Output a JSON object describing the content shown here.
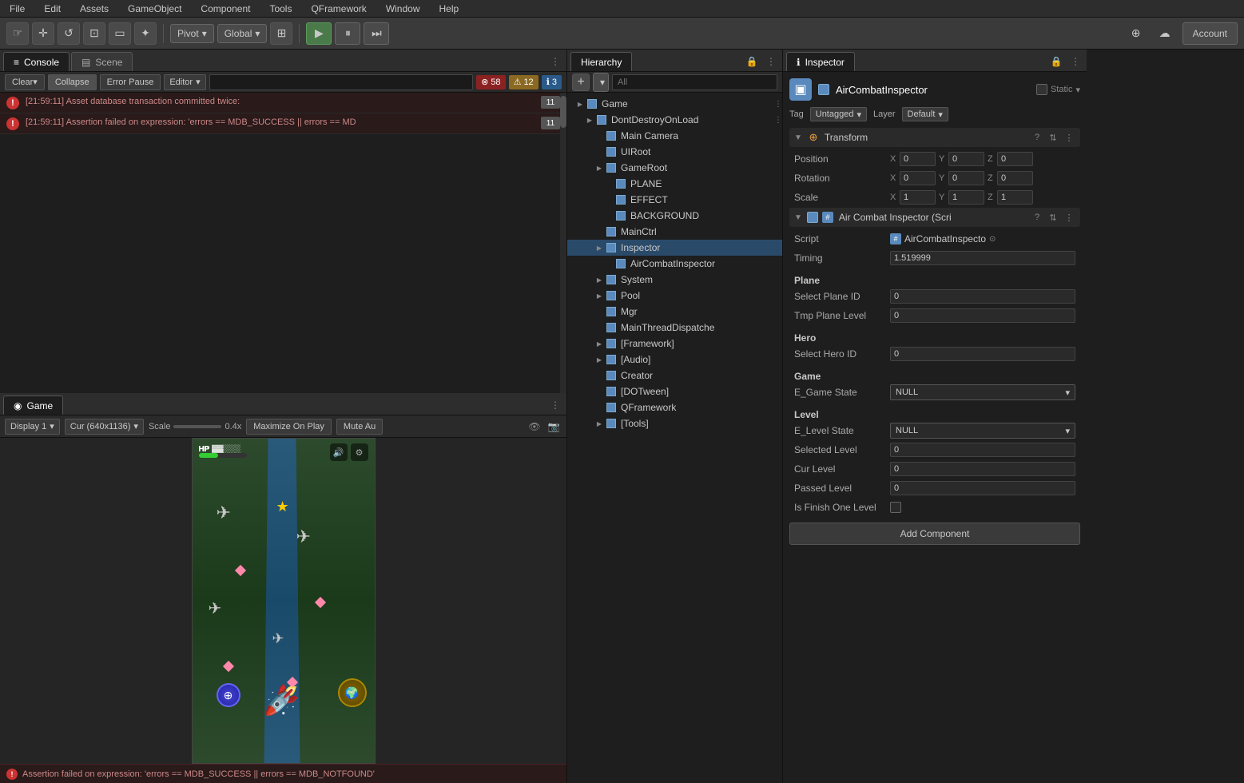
{
  "menu": {
    "items": [
      "File",
      "Edit",
      "Assets",
      "GameObject",
      "Component",
      "Tools",
      "QFramework",
      "Window",
      "Help"
    ]
  },
  "toolbar": {
    "tools": [
      "hand",
      "move",
      "rotate",
      "scale",
      "rect",
      "transform"
    ],
    "pivot_label": "Pivot",
    "global_label": "Global",
    "play_label": "▶",
    "pause_label": "⏸",
    "step_label": "⏭",
    "account_label": "Account"
  },
  "console": {
    "tab_label": "Console",
    "scene_tab_label": "Scene",
    "clear_label": "Clear",
    "collapse_label": "Collapse",
    "error_pause_label": "Error Pause",
    "editor_label": "Editor",
    "search_placeholder": "",
    "error_count": "58",
    "warn_count": "12",
    "info_count": "3",
    "messages": [
      {
        "type": "error",
        "text": "[21:59:11] Asset database transaction committed twice:",
        "count": "11"
      },
      {
        "type": "error",
        "text": "[21:59:11] Assertion failed on expression: 'errors == MDB_SUCCESS || errors == MD",
        "count": "11"
      }
    ]
  },
  "game": {
    "tab_label": "Game",
    "display_label": "Display 1",
    "resolution_label": "Cur (640x1136)",
    "scale_label": "Scale",
    "scale_value": "0.4x",
    "maximize_label": "Maximize On Play",
    "mute_label": "Mute Au"
  },
  "error_bar": {
    "text": "Assertion failed on expression: 'errors == MDB_SUCCESS || errors == MDB_NOTFOUND'"
  },
  "hierarchy": {
    "tab_label": "Hierarchy",
    "search_placeholder": "All",
    "items": [
      {
        "label": "Game",
        "level": 0,
        "has_children": true,
        "icon": "cube"
      },
      {
        "label": "DontDestroyOnLoad",
        "level": 1,
        "has_children": true,
        "icon": "cube",
        "has_menu": true
      },
      {
        "label": "Main Camera",
        "level": 2,
        "has_children": false,
        "icon": "cube"
      },
      {
        "label": "UIRoot",
        "level": 2,
        "has_children": false,
        "icon": "cube"
      },
      {
        "label": "GameRoot",
        "level": 2,
        "has_children": true,
        "icon": "cube"
      },
      {
        "label": "PLANE",
        "level": 3,
        "has_children": false,
        "icon": "cube"
      },
      {
        "label": "EFFECT",
        "level": 3,
        "has_children": false,
        "icon": "cube"
      },
      {
        "label": "BACKGROUND",
        "level": 3,
        "has_children": false,
        "icon": "cube"
      },
      {
        "label": "MainCtrl",
        "level": 2,
        "has_children": false,
        "icon": "cube"
      },
      {
        "label": "Inspector",
        "level": 2,
        "has_children": true,
        "icon": "cube",
        "selected": true
      },
      {
        "label": "AirCombatInspector",
        "level": 3,
        "has_children": false,
        "icon": "cube"
      },
      {
        "label": "System",
        "level": 2,
        "has_children": true,
        "icon": "cube"
      },
      {
        "label": "Pool",
        "level": 2,
        "has_children": true,
        "icon": "cube"
      },
      {
        "label": "Mgr",
        "level": 2,
        "has_children": false,
        "icon": "cube"
      },
      {
        "label": "MainThreadDispatche",
        "level": 2,
        "has_children": false,
        "icon": "cube"
      },
      {
        "label": "[Framework]",
        "level": 2,
        "has_children": true,
        "icon": "cube"
      },
      {
        "label": "[Audio]",
        "level": 2,
        "has_children": true,
        "icon": "cube"
      },
      {
        "label": "Creator",
        "level": 2,
        "has_children": false,
        "icon": "cube"
      },
      {
        "label": "[DOTween]",
        "level": 2,
        "has_children": false,
        "icon": "cube"
      },
      {
        "label": "QFramework",
        "level": 2,
        "has_children": false,
        "icon": "cube"
      },
      {
        "label": "[Tools]",
        "level": 2,
        "has_children": true,
        "icon": "cube"
      }
    ]
  },
  "inspector": {
    "tab_label": "Inspector",
    "component_name": "AirCombatInspector",
    "static_label": "Static",
    "tag_label": "Tag",
    "tag_value": "Untagged",
    "layer_label": "Layer",
    "layer_value": "Default",
    "transform": {
      "title": "Transform",
      "position_label": "Position",
      "position_x": "0",
      "position_y": "0",
      "position_z": "0",
      "rotation_label": "Rotation",
      "rotation_x": "0",
      "rotation_y": "0",
      "rotation_z": "0",
      "scale_label": "Scale",
      "scale_x": "1",
      "scale_y": "1",
      "scale_z": "1"
    },
    "script_component": {
      "title": "Air Combat Inspector (Scri",
      "script_label": "Script",
      "script_value": "AirCombatInspecto",
      "timing_label": "Timing",
      "timing_value": "1.519999"
    },
    "plane": {
      "section_label": "Plane",
      "select_plane_id_label": "Select Plane ID",
      "select_plane_id_value": "0",
      "tmp_plane_level_label": "Tmp Plane Level",
      "tmp_plane_level_value": "0"
    },
    "hero": {
      "section_label": "Hero",
      "select_hero_id_label": "Select Hero ID",
      "select_hero_id_value": "0"
    },
    "game": {
      "section_label": "Game",
      "e_game_state_label": "E_Game State",
      "e_game_state_value": "NULL"
    },
    "level": {
      "section_label": "Level",
      "e_level_state_label": "E_Level State",
      "e_level_state_value": "NULL",
      "selected_level_label": "Selected Level",
      "selected_level_value": "0",
      "cur_level_label": "Cur Level",
      "cur_level_value": "0",
      "passed_level_label": "Passed Level",
      "passed_level_value": "0",
      "is_finish_label": "Is Finish One Level"
    },
    "add_component_label": "Add Component"
  }
}
